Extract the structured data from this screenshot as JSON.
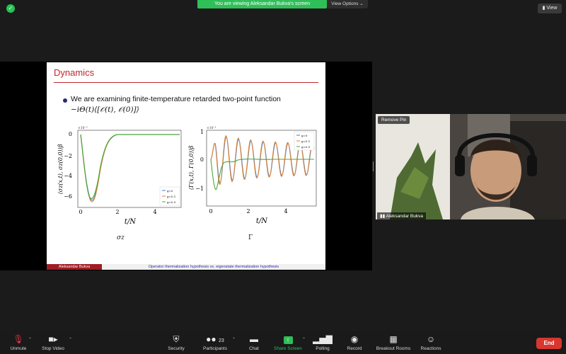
{
  "top": {
    "banner": "You are viewing Aleksandar Bukva's screen",
    "view_options": "View Options ⌄",
    "view_button": "View"
  },
  "slide": {
    "title": "Dynamics",
    "bullet": "We are examining finite-temperature retarded two-point function",
    "formula": "−iΘ(t)⟨[𝒪(t), 𝒪(0)]⟩",
    "caption_left": "σz",
    "caption_right": "Γ",
    "footer_author": "Aleksandar Bukva",
    "footer_title": "Operator thermalization hypothesis vs. eigenstate thermalization hypothesis",
    "left_plot": {
      "ylabel": "⟨σz(x,t), σz(0,0)⟩β",
      "xlabel": "t/N",
      "scale": "×10⁻²",
      "yticks": [
        "0",
        "−2",
        "−4",
        "−6"
      ],
      "xticks": [
        "0",
        "2",
        "4"
      ],
      "legend": [
        "g=0",
        "g=0.1",
        "g=0.5"
      ]
    },
    "right_plot": {
      "ylabel": "⟨Γ(x,t), Γ(0,0)⟩β",
      "xlabel": "t/N",
      "scale": "×10⁻¹",
      "yticks": [
        "1",
        "0",
        "−1"
      ],
      "xticks": [
        "0",
        "2",
        "4"
      ],
      "legend": [
        "g=0",
        "g=0.1",
        "g=0.5"
      ]
    },
    "series_colors": [
      "#3b7dd8",
      "#e8822a",
      "#4aa83a"
    ]
  },
  "video": {
    "remove_pin": "Remove Pin",
    "name": "Aleksandar Bukva"
  },
  "toolbar": {
    "unmute": "Unmute",
    "stop_video": "Stop Video",
    "security": "Security",
    "participants": "Participants",
    "participants_count": "23",
    "chat": "Chat",
    "share_screen": "Share Screen",
    "polling": "Polling",
    "record": "Record",
    "breakout_rooms": "Breakout Rooms",
    "reactions": "Reactions",
    "end": "End"
  }
}
